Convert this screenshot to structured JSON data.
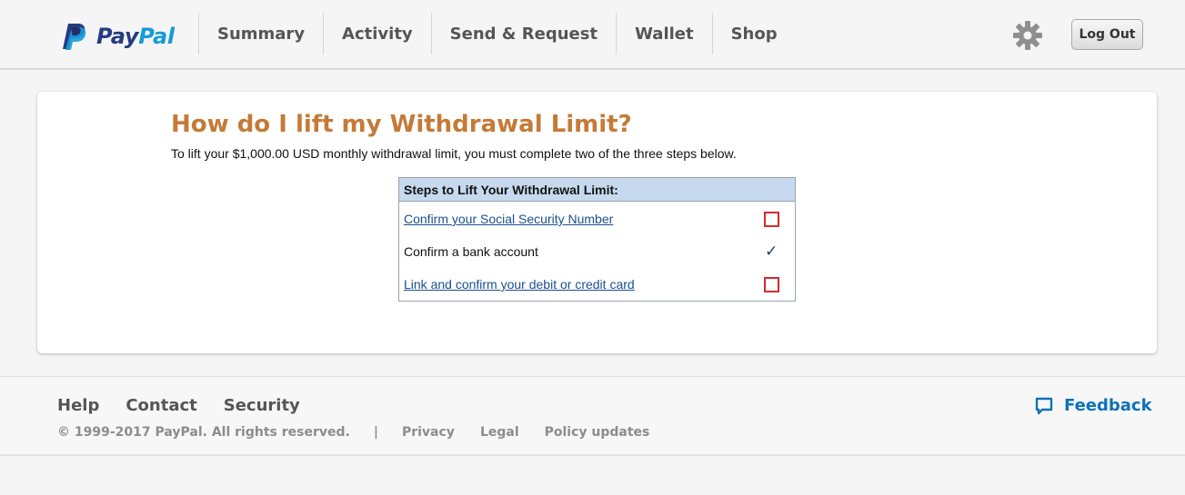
{
  "header": {
    "logo_pay": "Pay",
    "logo_pal": "Pal",
    "nav": [
      "Summary",
      "Activity",
      "Send & Request",
      "Wallet",
      "Shop"
    ],
    "settings_icon": "gear-icon",
    "logout_label": "Log Out"
  },
  "main": {
    "title": "How do I lift my Withdrawal Limit?",
    "intro": "To lift your $1,000.00 USD monthly withdrawal limit, you must complete two of the three steps below.",
    "steps_header": "Steps to Lift Your Withdrawal Limit:",
    "steps": [
      {
        "label": "Confirm your Social Security Number",
        "status": "incomplete",
        "is_link": true
      },
      {
        "label": "Confirm a bank account",
        "status": "complete",
        "is_link": false
      },
      {
        "label": "Link and confirm your debit or credit card",
        "status": "incomplete",
        "is_link": true
      }
    ]
  },
  "footer": {
    "links": [
      "Help",
      "Contact",
      "Security"
    ],
    "copyright": "© 1999-2017 PayPal. All rights reserved.",
    "separator": "|",
    "legal_links": [
      "Privacy",
      "Legal",
      "Policy updates"
    ],
    "feedback_label": "Feedback"
  },
  "colors": {
    "title": "#c57a37",
    "link": "#1a4f8f",
    "table_header": "#c6d9ee",
    "unchecked_box": "#d52b2b",
    "feedback": "#0e72b5",
    "brand_dark": "#253b80",
    "brand_light": "#179bd7"
  }
}
